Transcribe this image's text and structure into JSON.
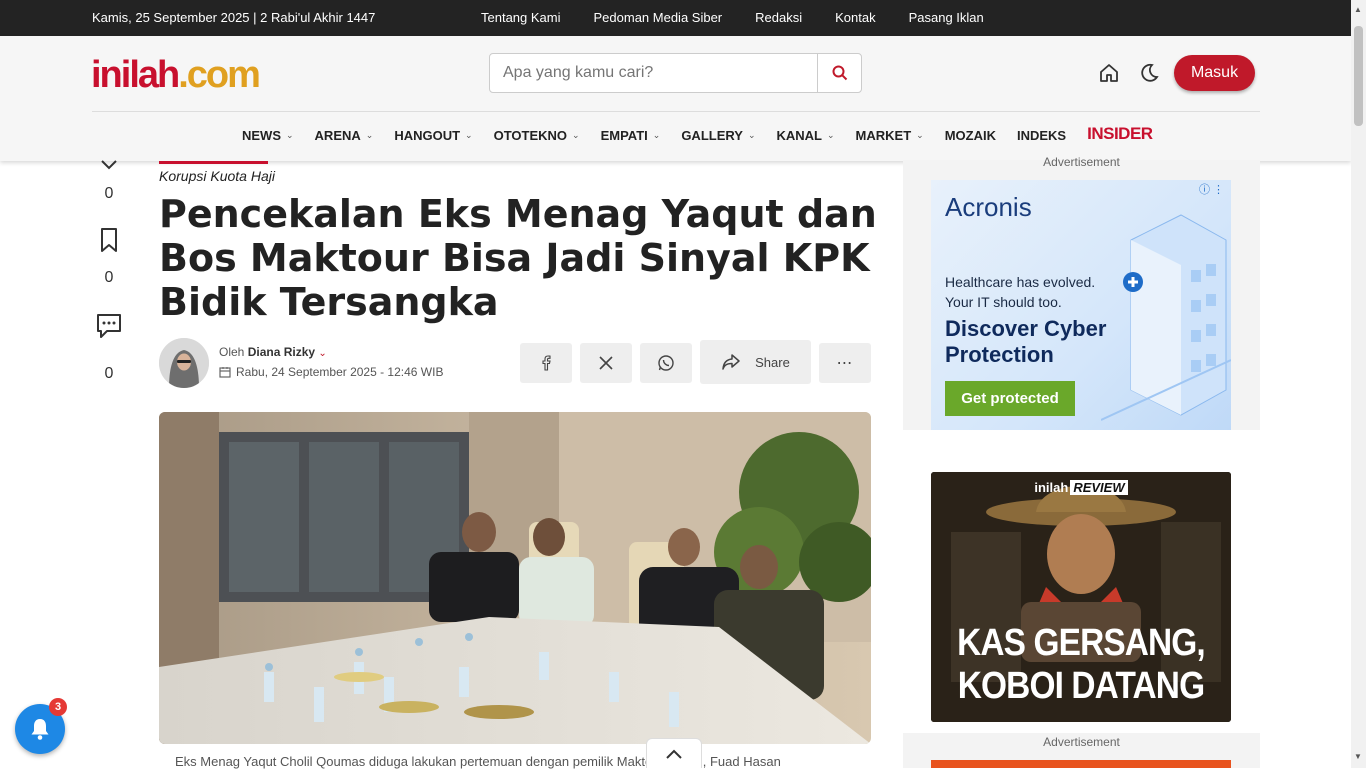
{
  "topbar": {
    "date": "Kamis, 25 September 2025 | 2 Rabi'ul Akhir 1447",
    "links": [
      "Tentang Kami",
      "Pedoman Media Siber",
      "Redaksi",
      "Kontak",
      "Pasang Iklan"
    ]
  },
  "header": {
    "logo_part1": "inilah",
    "logo_part2": "com",
    "search_placeholder": "Apa yang kamu cari?",
    "login_label": "Masuk"
  },
  "nav": {
    "items": [
      {
        "label": "NEWS",
        "dropdown": true
      },
      {
        "label": "ARENA",
        "dropdown": true
      },
      {
        "label": "HANGOUT",
        "dropdown": true
      },
      {
        "label": "OTOTEKNO",
        "dropdown": true
      },
      {
        "label": "EMPATI",
        "dropdown": true
      },
      {
        "label": "GALLERY",
        "dropdown": true
      },
      {
        "label": "KANAL",
        "dropdown": true
      },
      {
        "label": "MARKET",
        "dropdown": true
      },
      {
        "label": "MOZAIK",
        "dropdown": false
      },
      {
        "label": "INDEKS",
        "dropdown": false
      }
    ],
    "insider_label": "INSIDER"
  },
  "side_actions": {
    "like_count": "0",
    "bookmark_count": "0",
    "comment_count": "0"
  },
  "article": {
    "category": "Korupsi Kuota Haji",
    "title": "Pencekalan Eks Menag Yaqut dan Bos Maktour Bisa Jadi Sinyal KPK Bidik Tersangka",
    "author_prefix": "Oleh",
    "author": "Diana Rizky",
    "published": "Rabu, 24 September 2025 - 12:46 WIB",
    "share_label": "Share",
    "caption": "Eks Menag Yaqut Cholil Qoumas diduga lakukan pertemuan dengan pemilik Maktour Travel, Fuad Hasan"
  },
  "ads": {
    "label": "Advertisement",
    "acronis": {
      "brand": "Acronis",
      "line1": "Healthcare has evolved.",
      "line2": "Your IT should too.",
      "headline1": "Discover Cyber",
      "headline2": "Protection",
      "cta": "Get protected"
    },
    "review": {
      "brand_part1": "inilah",
      "brand_part2": "REVIEW",
      "headline1": "KAS GERSANG,",
      "headline2": "KOBOI DATANG"
    }
  },
  "notifications": {
    "count": "3"
  },
  "colors": {
    "brand_red": "#c0192a",
    "brand_gold": "#e0a020",
    "topbar_bg": "#232323",
    "notif_blue": "#1e88e5"
  }
}
